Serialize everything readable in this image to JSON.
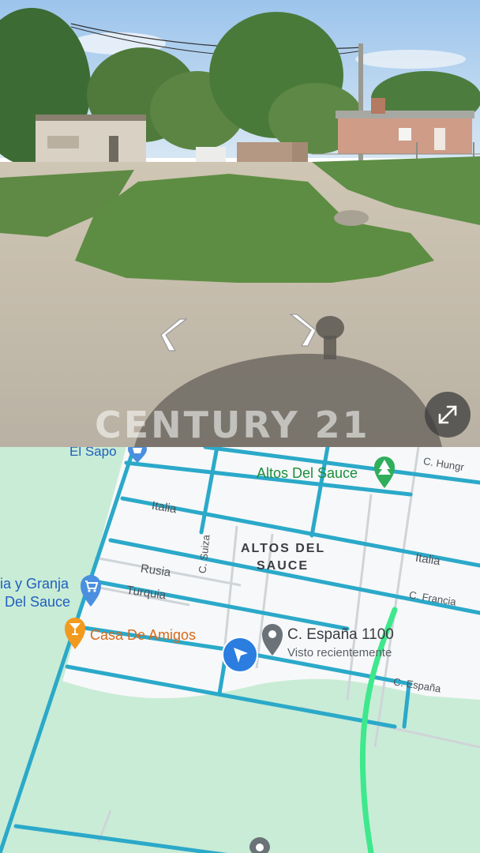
{
  "street_view": {
    "watermark": "CENTURY 21",
    "nav_left_icon": "chevron-left",
    "nav_right_icon": "chevron-right",
    "expand_icon": "expand-arrows"
  },
  "map": {
    "places": {
      "el_sapo": "El Sapo",
      "altos_del_sauce_park": "Altos Del Sauce",
      "granja_line1": "ia y Granja",
      "granja_line2": "Del Sauce",
      "casa_de_amigos": "Casa De Amigos",
      "destination_title": "C. España 1100",
      "destination_subtitle": "Visto recientemente"
    },
    "neighborhood": {
      "line1": "ALTOS DEL",
      "line2": "SAUCE"
    },
    "streets": {
      "hungria": "C. Hungr",
      "italia_left": "Italia",
      "italia_right": "Italia",
      "suiza": "C. Suiza",
      "rusia": "Rusia",
      "turquia": "Turquia",
      "francia": "C. Francia",
      "espana": "C. España"
    },
    "colors": {
      "road_highlight": "#2ba9c9",
      "park_green": "#c9ecd6",
      "route_line": "#3ee88c",
      "location_arrow": "#2b7de0",
      "pin_gray": "#6b7278",
      "park_pin": "#2fae5c",
      "shop_pin": "#4a8fe0",
      "bar_pin": "#f29a1e"
    }
  }
}
